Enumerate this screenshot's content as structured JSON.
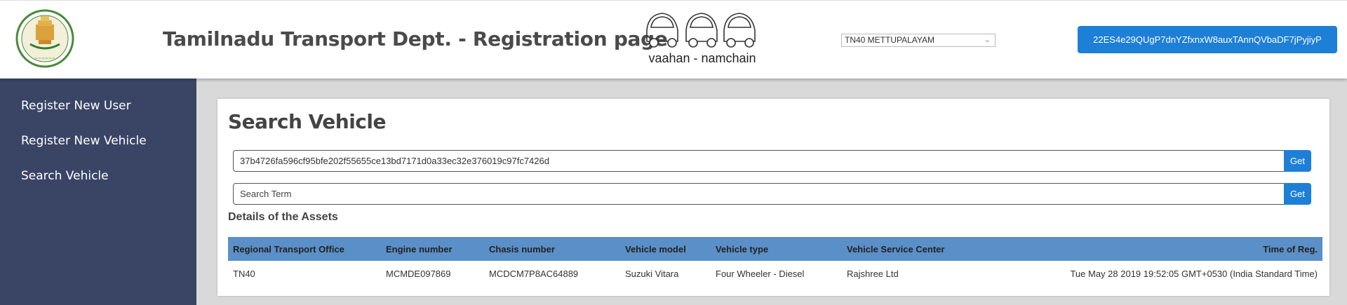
{
  "header": {
    "title": "Tamilnadu Transport Dept. - Registration page",
    "brand": "vaahan - namchain",
    "rto_selected": "TN40 METTUPALAYAM",
    "account_address": "22ES4e29QUgP7dnYZfxnxW8auxTAnnQVbaDF7jPyjiyP"
  },
  "sidebar": {
    "items": [
      {
        "label": "Register New User"
      },
      {
        "label": "Register New Vehicle"
      },
      {
        "label": "Search Vehicle"
      }
    ]
  },
  "main": {
    "title": "Search Vehicle",
    "hash_field": {
      "value": "37b4726fa596cf95bfe202f55655ce13bd7171d0a33ec32e376019c97fc7426d"
    },
    "search_field": {
      "placeholder": "Search Term"
    },
    "get_label": "Get",
    "section_title": "Details of the Assets",
    "table": {
      "headers": [
        "Regional Transport Office",
        "Engine number",
        "Chasis number",
        "Vehicle model",
        "Vehicle type",
        "Vehicle Service Center",
        "Time of Reg."
      ],
      "rows": [
        [
          "TN40",
          "MCMDE097869",
          "MCDCM7P8AC64889",
          "Suzuki Vitara",
          "Four Wheeler - Diesel",
          "Rajshree Ltd",
          "Tue May 28 2019 19:52:05 GMT+0530 (India Standard Time)"
        ]
      ]
    }
  },
  "colors": {
    "sidebar_bg": "#3a4566",
    "accent": "#1e7fd6",
    "table_header": "#5b8fc7"
  }
}
